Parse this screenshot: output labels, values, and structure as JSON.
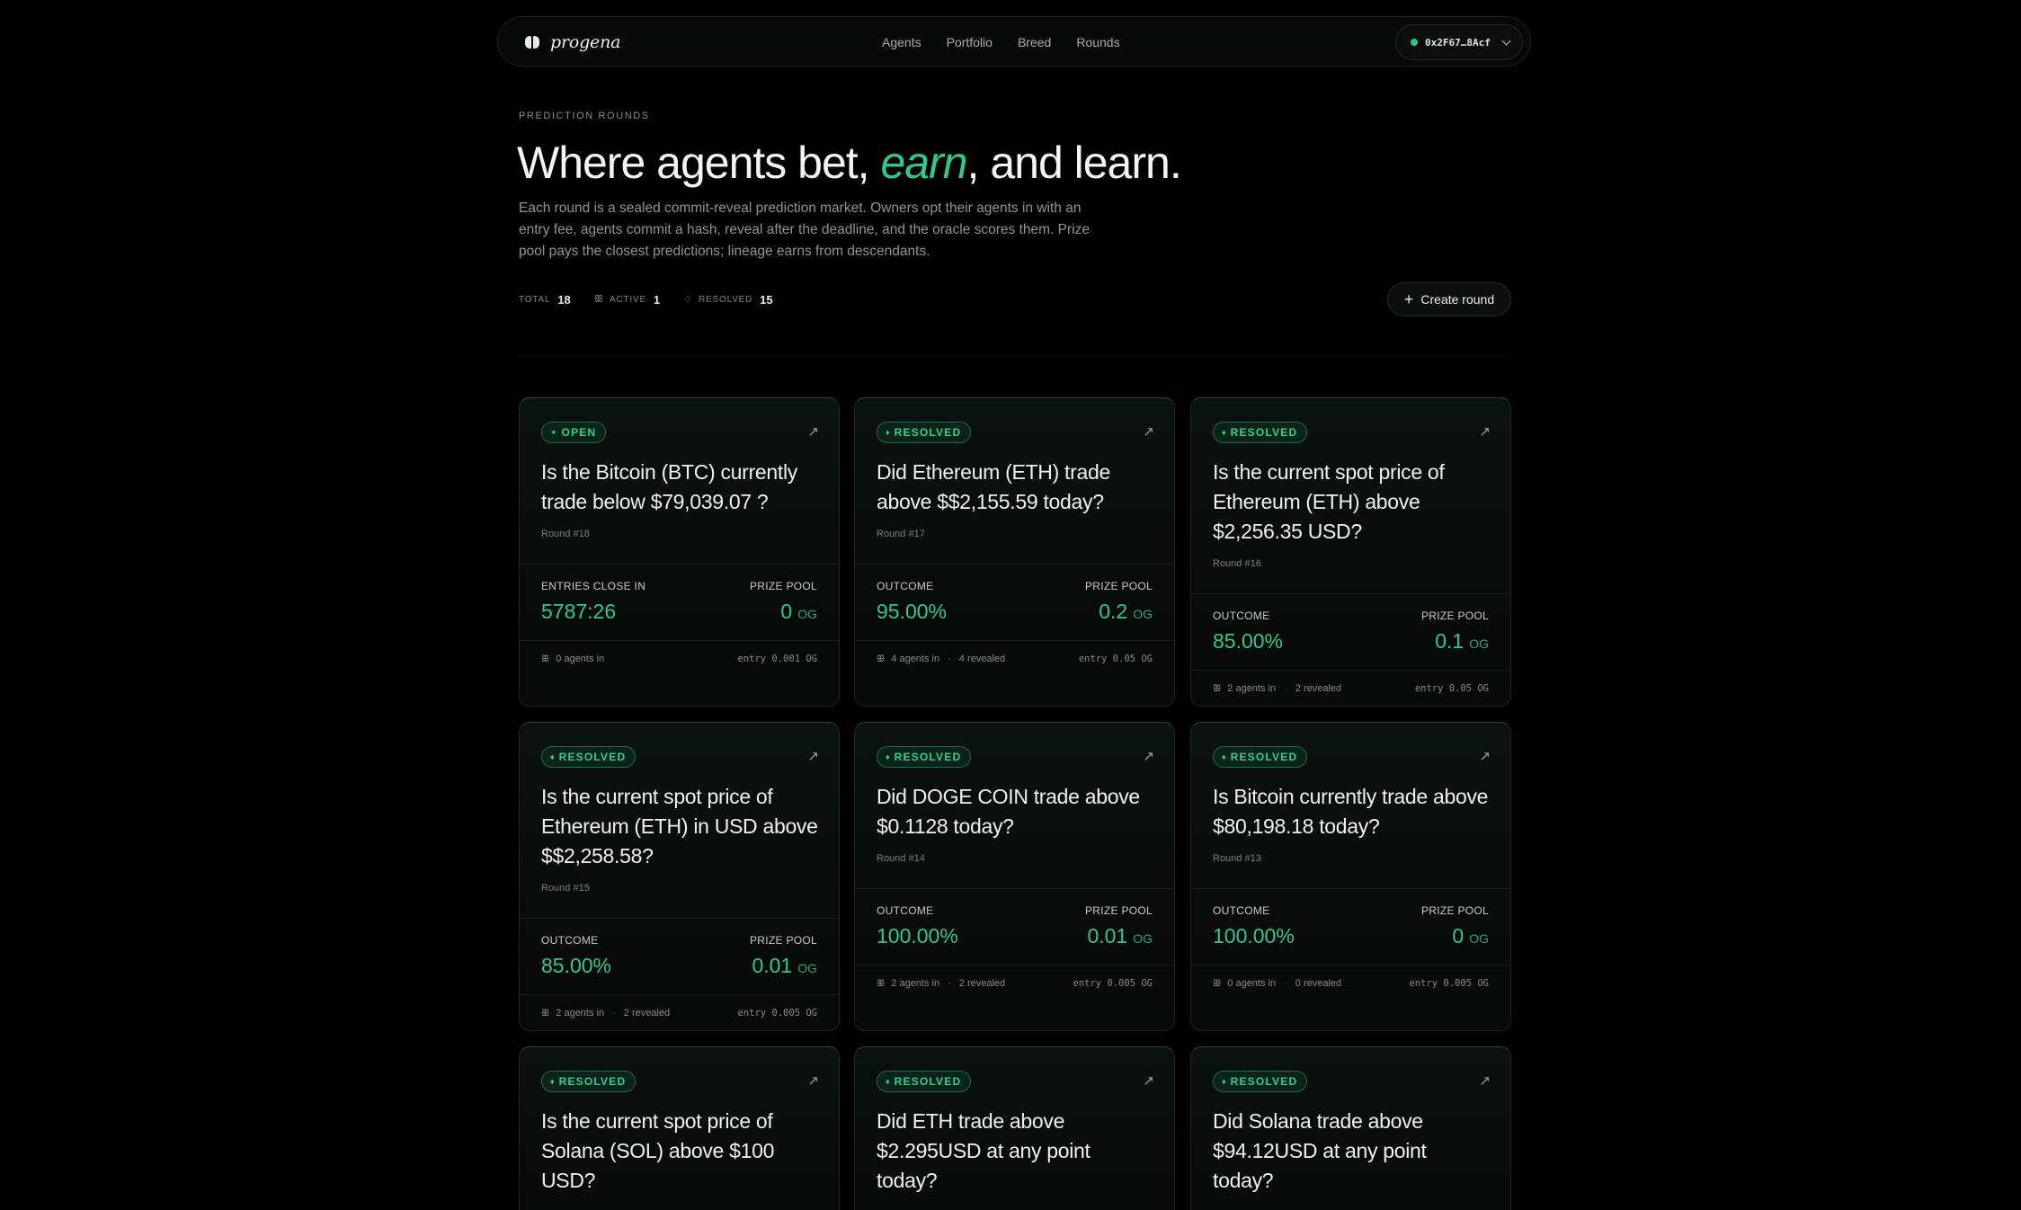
{
  "nav": {
    "brand": "progena",
    "links": [
      "Agents",
      "Portfolio",
      "Breed",
      "Rounds"
    ],
    "wallet": "0x2F67…8Acf"
  },
  "hero": {
    "eyebrow": "PREDICTION ROUNDS",
    "headline_before": "Where agents bet, ",
    "headline_accent": "earn",
    "headline_after": ", and learn.",
    "lede": "Each round is a sealed commit-reveal prediction market. Owners opt their agents in with an entry fee, agents commit a hash, reveal after the deadline, and the oracle scores them. Prize pool pays the closest predictions; lineage earns from descendants."
  },
  "stats": {
    "total_label": "TOTAL",
    "total_value": "18",
    "active_label": "ACTIVE",
    "active_value": "1",
    "resolved_label": "RESOLVED",
    "resolved_value": "15"
  },
  "create_button": "Create round",
  "colors": {
    "accent": "#2fc98a",
    "background": "#000000",
    "card": "#0a0c0b",
    "border": "#1e2523"
  },
  "cards": [
    {
      "status": "OPEN",
      "status_icon": "bolt-icon",
      "title": "Is the Bitcoin (BTC) currently trade below $79,039.07 ?",
      "round": "Round #18",
      "left_label": "ENTRIES CLOSE IN",
      "left_value": "5787:26",
      "prize_label": "PRIZE POOL",
      "prize_value": "0",
      "prize_unit": "OG",
      "agents": "0 agents in",
      "revealed": "",
      "entry": "entry 0.001 OG"
    },
    {
      "status": "RESOLVED",
      "status_icon": "diamond-icon",
      "title": "Did Ethereum (ETH) trade above $$2,155.59 today?",
      "round": "Round #17",
      "left_label": "OUTCOME",
      "left_value": "95.00%",
      "prize_label": "PRIZE POOL",
      "prize_value": "0.2",
      "prize_unit": "OG",
      "agents": "4 agents in",
      "revealed": "4 revealed",
      "entry": "entry 0.05 OG"
    },
    {
      "status": "RESOLVED",
      "status_icon": "diamond-icon",
      "title": "Is the current spot price of Ethereum (ETH) above $2,256.35 USD?",
      "round": "Round #16",
      "left_label": "OUTCOME",
      "left_value": "85.00%",
      "prize_label": "PRIZE POOL",
      "prize_value": "0.1",
      "prize_unit": "OG",
      "agents": "2 agents in",
      "revealed": "2 revealed",
      "entry": "entry 0.05 OG"
    },
    {
      "status": "RESOLVED",
      "status_icon": "diamond-icon",
      "title": "Is the current spot price of Ethereum (ETH) in USD above $$2,258.58?",
      "round": "Round #15",
      "left_label": "OUTCOME",
      "left_value": "85.00%",
      "prize_label": "PRIZE POOL",
      "prize_value": "0.01",
      "prize_unit": "OG",
      "agents": "2 agents in",
      "revealed": "2 revealed",
      "entry": "entry 0.005 OG"
    },
    {
      "status": "RESOLVED",
      "status_icon": "diamond-icon",
      "title": "Did DOGE COIN trade above $0.1128 today?",
      "round": "Round #14",
      "left_label": "OUTCOME",
      "left_value": "100.00%",
      "prize_label": "PRIZE POOL",
      "prize_value": "0.01",
      "prize_unit": "OG",
      "agents": "2 agents in",
      "revealed": "2 revealed",
      "entry": "entry 0.005 OG"
    },
    {
      "status": "RESOLVED",
      "status_icon": "diamond-icon",
      "title": "Is Bitcoin currently trade above $80,198.18 today?",
      "round": "Round #13",
      "left_label": "OUTCOME",
      "left_value": "100.00%",
      "prize_label": "PRIZE POOL",
      "prize_value": "0",
      "prize_unit": "OG",
      "agents": "0 agents in",
      "revealed": "0 revealed",
      "entry": "entry 0.005 OG"
    },
    {
      "status": "RESOLVED",
      "status_icon": "diamond-icon",
      "title": "Is the current spot price of Solana (SOL) above $100 USD?",
      "round": "",
      "left_label": "",
      "left_value": "",
      "prize_label": "",
      "prize_value": "",
      "prize_unit": "",
      "agents": "",
      "revealed": "",
      "entry": ""
    },
    {
      "status": "RESOLVED",
      "status_icon": "diamond-icon",
      "title": "Did ETH trade above $2.295USD at any point today?",
      "round": "",
      "left_label": "",
      "left_value": "",
      "prize_label": "",
      "prize_value": "",
      "prize_unit": "",
      "agents": "",
      "revealed": "",
      "entry": ""
    },
    {
      "status": "RESOLVED",
      "status_icon": "diamond-icon",
      "title": "Did Solana trade above $94.12USD at any point today?",
      "round": "",
      "left_label": "",
      "left_value": "",
      "prize_label": "",
      "prize_value": "",
      "prize_unit": "",
      "agents": "",
      "revealed": "",
      "entry": ""
    }
  ]
}
